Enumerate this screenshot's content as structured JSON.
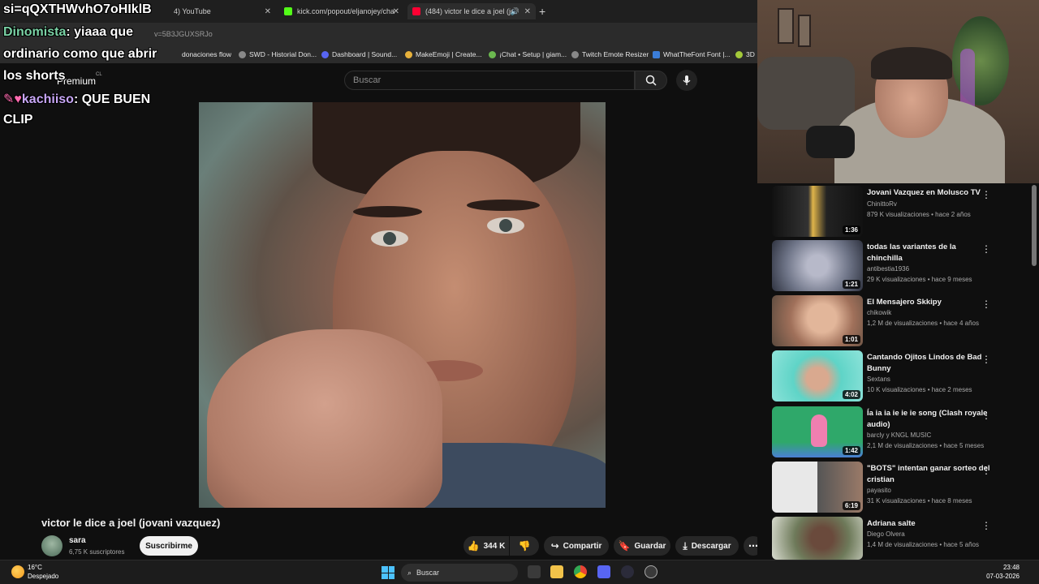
{
  "browser": {
    "tabs": [
      {
        "label": "(484) YouTube",
        "partial_label": "4) YouTube"
      },
      {
        "label": "kick.com/popout/eljanojey/cha"
      },
      {
        "label": "(484) victor le dice a joel (jo"
      }
    ],
    "url": "v=5B3JGUXSRJo",
    "bookmarks": [
      "donaciones flow",
      "SWD - Historial Don...",
      "Dashboard | Sound...",
      "MakeEmoji | Create...",
      "¡Chat • Setup | giam...",
      "Twitch Emote Resizer",
      "WhatTheFont Font |...",
      "3D"
    ]
  },
  "youtube": {
    "premium_label": "Premium",
    "country": "CL",
    "search_placeholder": "Buscar"
  },
  "chat": [
    {
      "text": "si=qQXTHWvhO7oHIklB"
    },
    {
      "user": "Dinomista",
      "text": "yiaaa que"
    },
    {
      "text": "ordinario como que abrir"
    },
    {
      "text": "los shorts"
    },
    {
      "user": "kachiiso",
      "text": "QUE BUEN"
    },
    {
      "text": "CLIP"
    }
  ],
  "video": {
    "title": "victor le dice a joel (jovani vazquez)",
    "channel": "sara",
    "subscribers": "6,75 K suscriptores",
    "subscribe_label": "Suscribirme",
    "likes": "344 K",
    "share_label": "Compartir",
    "save_label": "Guardar",
    "download_label": "Descargar"
  },
  "recommendations": [
    {
      "title": "Jovani Vazquez en Molusco TV",
      "channel": "ChinittoRv",
      "meta": "879 K visualizaciones • hace 2 años",
      "duration": "1:36",
      "color": "#1a1a1a"
    },
    {
      "title": "todas las variantes de la chinchilla",
      "channel": "antibestia1936",
      "meta": "29 K visualizaciones • hace 9 meses",
      "duration": "1:21",
      "color": "#8d8fa3"
    },
    {
      "title": "El Mensajero Skkipy",
      "channel": "chikowik",
      "meta": "1,2 M de visualizaciones • hace 4 años",
      "duration": "1:01",
      "color": "#b7896a"
    },
    {
      "title": "Cantando Ojitos Lindos de Bad Bunny",
      "channel": "Sextans",
      "meta": "10 K visualizaciones • hace 2 meses",
      "duration": "4:02",
      "color": "#5fd4c7"
    },
    {
      "title": "Ía ia ia ie ie ie song (Clash royale audio)",
      "channel": "barcly y KNGL MUSIC",
      "meta": "2,1 M de visualizaciones • hace 5 meses",
      "duration": "1:42",
      "color": "#2fa86a"
    },
    {
      "title": "\"BOTS\" intentan ganar sorteo del cristian",
      "channel": "payasito",
      "meta": "31 K visualizaciones • hace 8 meses",
      "duration": "6:19",
      "color": "#d9d9d9"
    },
    {
      "title": "Adriana salte",
      "channel": "Diego Olvera",
      "meta": "1,4 M de visualizaciones • hace 5 años",
      "duration": "",
      "color": "#6e7a5a"
    }
  ],
  "taskbar": {
    "temperature": "16°C",
    "weather": "Despejado",
    "search_label": "Buscar",
    "time": "23:48",
    "date": "07-03-2026"
  }
}
